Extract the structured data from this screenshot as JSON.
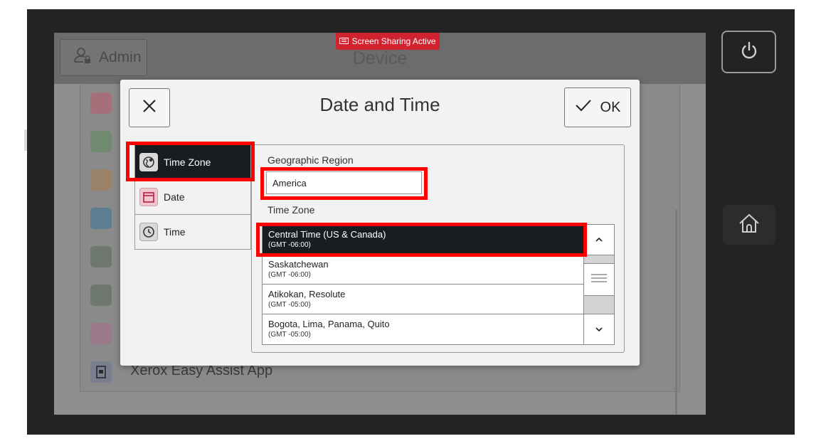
{
  "header": {
    "admin_label": "Admin",
    "device_title": "Device",
    "sharing_badge": "Screen Sharing Active"
  },
  "background_list": {
    "visible_item_label": "Xerox Easy Assist App"
  },
  "dialog": {
    "title": "Date and Time",
    "ok_label": "OK",
    "tabs": [
      {
        "label": "Time Zone",
        "icon": "globe-icon",
        "selected": true
      },
      {
        "label": "Date",
        "icon": "calendar-icon",
        "selected": false
      },
      {
        "label": "Time",
        "icon": "clock-icon",
        "selected": false
      }
    ],
    "region_label": "Geographic Region",
    "region_value": "America",
    "timezone_label": "Time Zone",
    "timezones": [
      {
        "name": "Central Time (US & Canada)",
        "offset": "(GMT -06:00)",
        "selected": true
      },
      {
        "name": "Saskatchewan",
        "offset": "(GMT -06:00)",
        "selected": false
      },
      {
        "name": "Atikokan, Resolute",
        "offset": "(GMT -05:00)",
        "selected": false
      },
      {
        "name": "Bogota, Lima, Panama, Quito",
        "offset": "(GMT -05:00)",
        "selected": false
      }
    ]
  },
  "colors": {
    "highlight": "#ff0000",
    "selected_bg": "#1a1d20",
    "badge": "#d1232f"
  }
}
